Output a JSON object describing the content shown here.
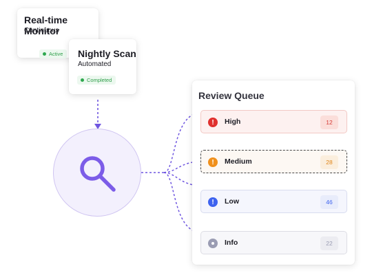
{
  "monitor_card": {
    "title": "Real-time Monitor",
    "subtitle": "Continuous",
    "status": "Active"
  },
  "scan_card": {
    "title": "Nightly Scan",
    "subtitle": "Automated",
    "status": "Completed"
  },
  "queue": {
    "title": "Review Queue",
    "items": [
      {
        "label": "High",
        "count": "12",
        "icon": "exclamation-icon"
      },
      {
        "label": "Medium",
        "count": "28",
        "icon": "exclamation-icon"
      },
      {
        "label": "Low",
        "count": "46",
        "icon": "exclamation-icon"
      },
      {
        "label": "Info",
        "count": "22",
        "icon": "dot-icon"
      }
    ]
  },
  "colors": {
    "accent": "#7c5ce8",
    "high": "#e0302e",
    "medium": "#f0901c",
    "low": "#3e63ef",
    "info": "#9a9cb3",
    "status_green": "#2ea84f"
  },
  "center_icon": "search-icon"
}
